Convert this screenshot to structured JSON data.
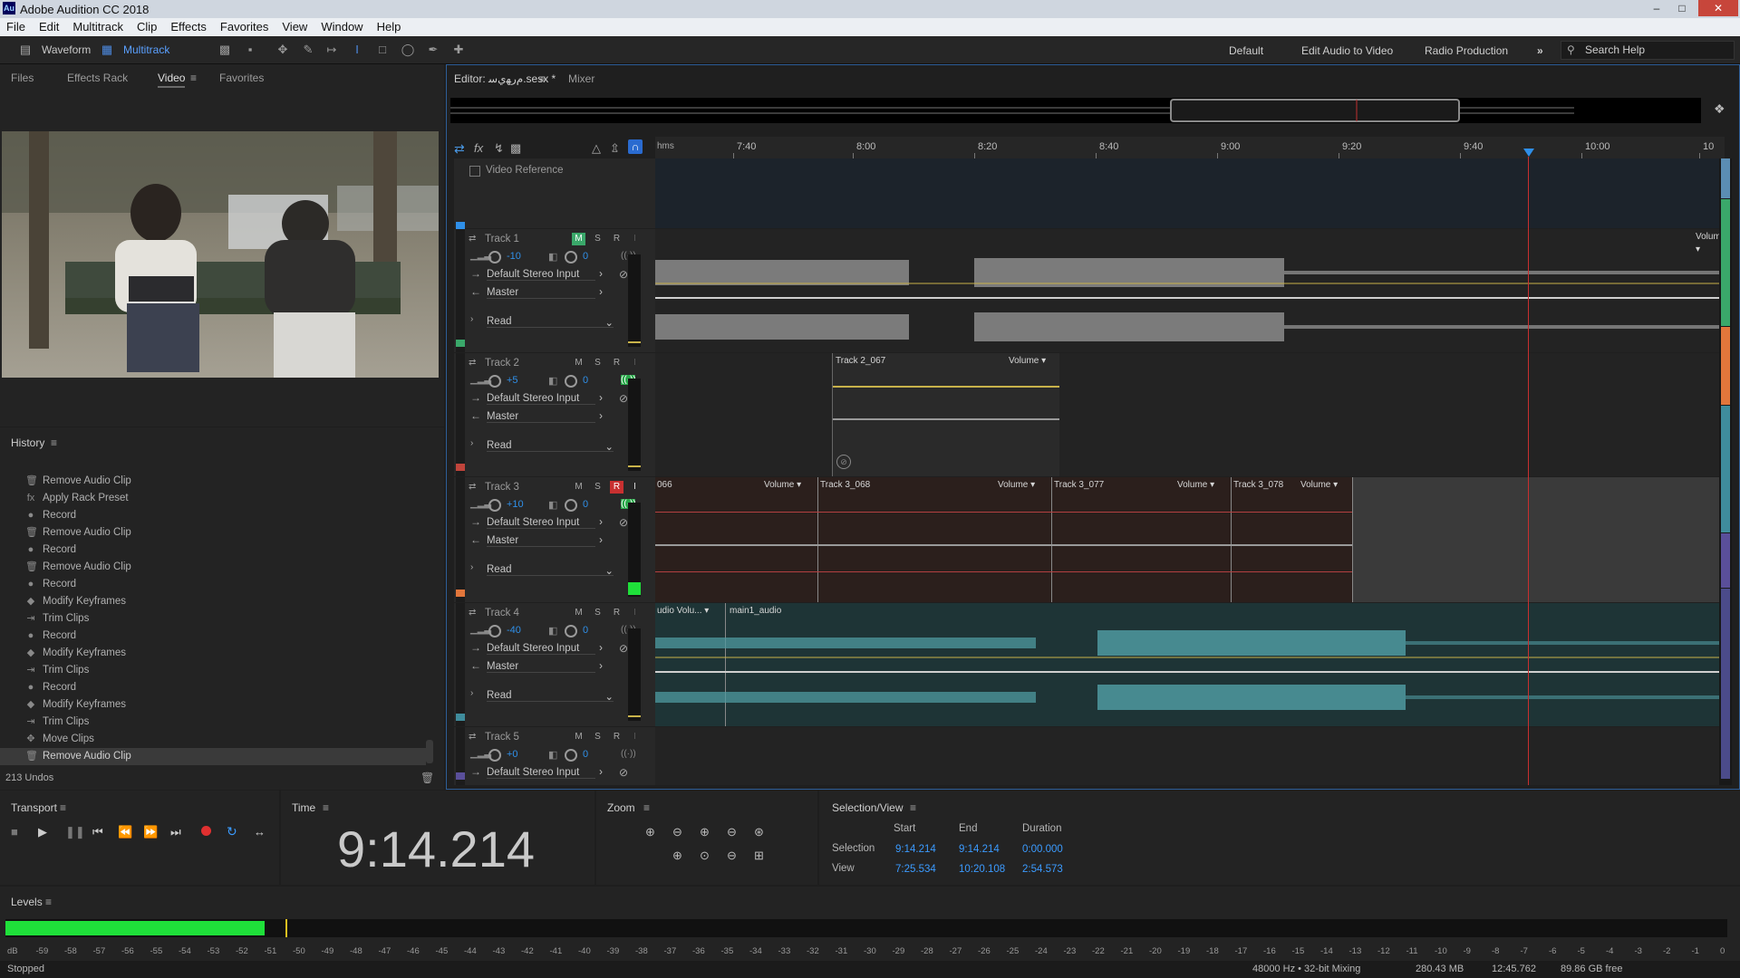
{
  "app": {
    "title": "Adobe Audition CC 2018",
    "logo": "Au"
  },
  "menu": [
    "File",
    "Edit",
    "Multitrack",
    "Clip",
    "Effects",
    "Favorites",
    "View",
    "Window",
    "Help"
  ],
  "toolbar": {
    "waveform": "Waveform",
    "multitrack": "Multitrack",
    "workspaces": [
      "Default",
      "Edit Audio to Video",
      "Radio Production"
    ],
    "search_placeholder": "Search Help"
  },
  "left_tabs": [
    "Files",
    "Effects Rack",
    "Video",
    "Favorites"
  ],
  "history": {
    "title": "History",
    "items": [
      {
        "icon": "trash-icon",
        "label": "Remove Audio Clip"
      },
      {
        "icon": "fx-icon",
        "label": "Apply Rack Preset"
      },
      {
        "icon": "record-icon",
        "label": "Record"
      },
      {
        "icon": "trash-icon",
        "label": "Remove Audio Clip"
      },
      {
        "icon": "record-icon",
        "label": "Record"
      },
      {
        "icon": "trash-icon",
        "label": "Remove Audio Clip"
      },
      {
        "icon": "record-icon",
        "label": "Record"
      },
      {
        "icon": "keyframe-icon",
        "label": "Modify Keyframes"
      },
      {
        "icon": "trim-icon",
        "label": "Trim Clips"
      },
      {
        "icon": "record-icon",
        "label": "Record"
      },
      {
        "icon": "keyframe-icon",
        "label": "Modify Keyframes"
      },
      {
        "icon": "trim-icon",
        "label": "Trim Clips"
      },
      {
        "icon": "record-icon",
        "label": "Record"
      },
      {
        "icon": "keyframe-icon",
        "label": "Modify Keyframes"
      },
      {
        "icon": "trim-icon",
        "label": "Trim Clips"
      },
      {
        "icon": "move-icon",
        "label": "Move Clips"
      },
      {
        "icon": "trash-icon",
        "label": "Remove Audio Clip"
      }
    ],
    "undos": "213 Undos"
  },
  "editor": {
    "tab": "Editor: ",
    "tab_name": "ﻡﺭﻬﻱﺳ.sesx *",
    "mixer": "Mixer",
    "video_reference": "Video Reference"
  },
  "ruler": {
    "hms": "hms",
    "labels": [
      "7:40",
      "8:00",
      "8:20",
      "8:40",
      "9:00",
      "9:20",
      "9:40",
      "10:00",
      "10"
    ]
  },
  "tracks": [
    {
      "name": "Track 1",
      "volume": "-10",
      "pan": "0",
      "input": "Default Stereo Input",
      "output": "Master",
      "automation": "Read"
    },
    {
      "name": "Track 2",
      "volume": "+5",
      "pan": "0",
      "input": "Default Stereo Input",
      "output": "Master",
      "automation": "Read"
    },
    {
      "name": "Track 3",
      "volume": "+10",
      "pan": "0",
      "input": "Default Stereo Input",
      "output": "Master",
      "automation": "Read"
    },
    {
      "name": "Track 4",
      "volume": "-40",
      "pan": "0",
      "input": "Default Stereo Input",
      "output": "Master",
      "automation": "Read"
    },
    {
      "name": "Track 5",
      "volume": "+0",
      "pan": "0",
      "input": "Default Stereo Input"
    }
  ],
  "clips": {
    "track1_volume": "Volume",
    "track2_clip": "Track 2_067",
    "track2_volume": "Volume",
    "track3_clip0": "066",
    "track3_clip0_volume": "Volume",
    "track3_clip1": "Track 3_068",
    "track3_clip1_volume": "Volume",
    "track3_clip2": "Track 3_077",
    "track3_clip2_volume": "Volume",
    "track3_clip3": "Track 3_078",
    "track3_clip3_volume": "Volume",
    "track4_clip0": "udio Volu...",
    "track4_clip1": "main1_audio"
  },
  "track_buttons": {
    "m": "M",
    "s": "S",
    "r": "R",
    "i": "I"
  },
  "transport": {
    "title": "Transport"
  },
  "time": {
    "title": "Time",
    "value": "9:14.214"
  },
  "zoom": {
    "title": "Zoom"
  },
  "selection_view": {
    "title": "Selection/View",
    "headers": [
      "Start",
      "End",
      "Duration"
    ],
    "selection_label": "Selection",
    "selection": [
      "9:14.214",
      "9:14.214",
      "0:00.000"
    ],
    "view_label": "View",
    "view": [
      "7:25.534",
      "10:20.108",
      "2:54.573"
    ]
  },
  "levels": {
    "title": "Levels",
    "scale": [
      "dB",
      "-59",
      "-58",
      "-57",
      "-56",
      "-55",
      "-54",
      "-53",
      "-52",
      "-51",
      "-50",
      "-49",
      "-48",
      "-47",
      "-46",
      "-45",
      "-44",
      "-43",
      "-42",
      "-41",
      "-40",
      "-39",
      "-38",
      "-37",
      "-36",
      "-35",
      "-34",
      "-33",
      "-32",
      "-31",
      "-30",
      "-29",
      "-28",
      "-27",
      "-26",
      "-25",
      "-24",
      "-23",
      "-22",
      "-21",
      "-20",
      "-19",
      "-18",
      "-17",
      "-16",
      "-15",
      "-14",
      "-13",
      "-12",
      "-11",
      "-10",
      "-9",
      "-8",
      "-7",
      "-6",
      "-5",
      "-4",
      "-3",
      "-2",
      "-1",
      "0"
    ]
  },
  "status": {
    "left": "Stopped",
    "sample": "48000 Hz • 32-bit Mixing",
    "mem": "280.43 MB",
    "dur": "12:45.762",
    "free": "89.86 GB free"
  },
  "colors": {
    "accent": "#2f8fe8",
    "track1": "#3aa86a",
    "track2": "#c0443b",
    "track3": "#e2763b",
    "track4": "#3f8c9c",
    "record": "#e03030"
  }
}
